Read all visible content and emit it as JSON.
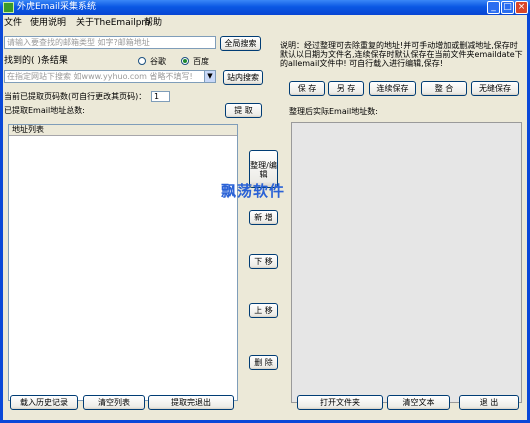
{
  "window": {
    "title": "外虎Email采集系统"
  },
  "menu": [
    "文件",
    "使用说明",
    "关于TheEmailpro",
    "帮助"
  ],
  "search": {
    "keyword_placeholder": "请输入要查找的邮箱类型 如字?邮箱地址",
    "global_search_label": "全局搜索",
    "found_label": "找到的(   )条结果",
    "engines": [
      {
        "label": "谷歌",
        "selected": false
      },
      {
        "label": "百度",
        "selected": true
      }
    ],
    "site_placeholder": "在指定网站下搜索 如www.yyhuo.com 省略不填写!",
    "site_search_label": "站内搜索"
  },
  "extract": {
    "page_count_label": "当前已提取页码数(可自行更改其页码)：",
    "page_count_value": "1",
    "total_label": "已提取Email地址总数:",
    "extract_button": "提 取",
    "list_header": "地址列表"
  },
  "middle_buttons": [
    "整理/编辑",
    "新 增",
    "下 移",
    "上 移",
    "删 除"
  ],
  "right": {
    "description": "说明：经过整理可去除重复的地址!并可手动增加或删减地址,保存时默认以日期为文件名,连续保存时默认保存在当前文件夹emaildate下的allemail文件中! 可自行载入进行编辑,保存!",
    "buttons": [
      "保 存",
      "另 存",
      "连续保存",
      "整 合",
      "无缝保存"
    ],
    "result_label": "整理后实际Email地址数:"
  },
  "bottom_buttons": {
    "left": [
      "载入历史记录",
      "清空列表",
      "提取完退出"
    ],
    "right": [
      "打开文件夹",
      "清空文本",
      "退 出"
    ]
  },
  "watermark": "飘荡软件",
  "colors": {
    "titlebar": "#0b58e4",
    "face": "#ece9d8",
    "watermark": "#2a62d6"
  }
}
